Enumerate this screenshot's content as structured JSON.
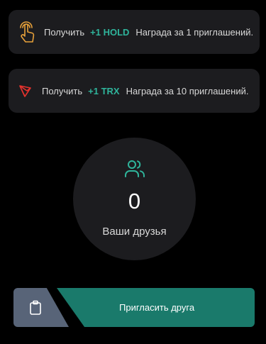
{
  "rewards": [
    {
      "icon": "tap-hand-icon",
      "prefix": "Получить",
      "amount": "+1 HOLD",
      "description": "Награда за 1 приглашений."
    },
    {
      "icon": "tron-icon",
      "prefix": "Получить",
      "amount": "+1 TRX",
      "description": "Награда за 10 приглашений."
    }
  ],
  "friends": {
    "icon": "users-icon",
    "count": "0",
    "label": "Ваши друзья"
  },
  "actions": {
    "copy_icon": "clipboard-icon",
    "invite_label": "Пригласить друга"
  },
  "colors": {
    "background": "#000000",
    "card": "#1c1c1f",
    "accent": "#2fb49b",
    "invite_button": "#1a7a6b",
    "copy_button": "#586478",
    "hand_icon": "#e8a13a",
    "tron_icon": "#e5322d"
  }
}
